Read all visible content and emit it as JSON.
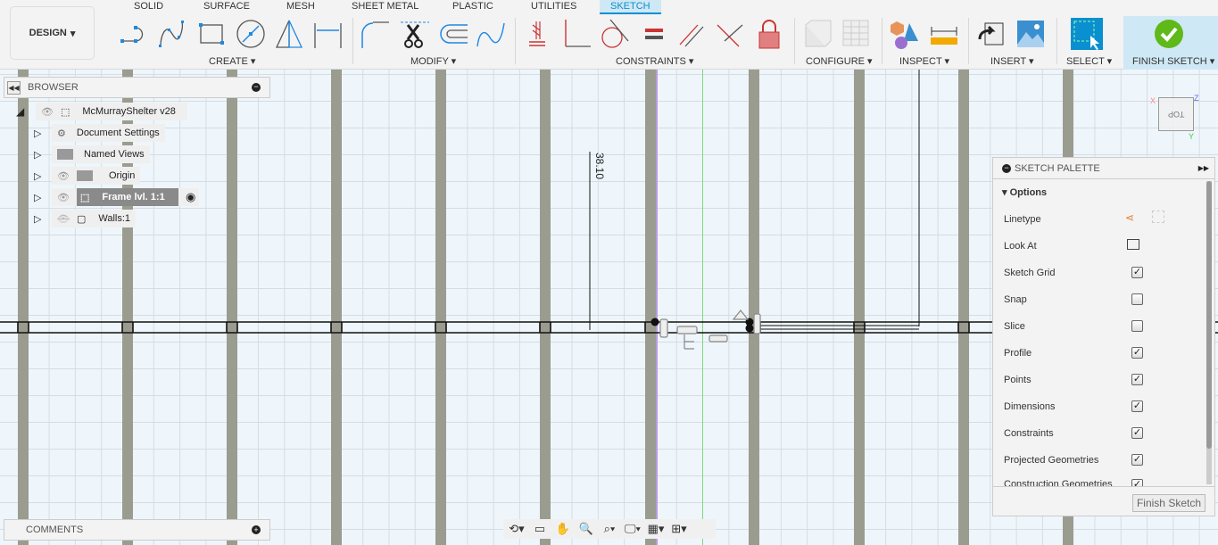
{
  "toolbar": {
    "workspace": "DESIGN",
    "tabs": [
      "SOLID",
      "SURFACE",
      "MESH",
      "SHEET METAL",
      "PLASTIC",
      "UTILITIES",
      "SKETCH"
    ],
    "active_tab": "SKETCH",
    "groups": {
      "create": "CREATE",
      "modify": "MODIFY",
      "constraints": "CONSTRAINTS",
      "configure": "CONFIGURE",
      "inspect": "INSPECT",
      "insert": "INSERT",
      "select": "SELECT",
      "finish": "FINISH SKETCH"
    },
    "accent": "#0a8fd0"
  },
  "browser": {
    "title": "BROWSER",
    "items": [
      {
        "label": "McMurrayShelter v28",
        "icon": "component-icon"
      },
      {
        "label": "Document Settings",
        "icon": "gear-icon"
      },
      {
        "label": "Named Views",
        "icon": "folder-icon"
      },
      {
        "label": "Origin",
        "icon": "folder-icon"
      },
      {
        "label": "Frame lvl. 1:1",
        "icon": "component-icon",
        "active": true
      },
      {
        "label": "Walls:1",
        "icon": "body-icon",
        "hidden": true
      }
    ]
  },
  "comments": {
    "title": "COMMENTS"
  },
  "viewport": {
    "dimension": "38.10",
    "viewcube": "TOP",
    "axes": [
      "X",
      "Y",
      "Z"
    ]
  },
  "palette": {
    "title": "SKETCH PALETTE",
    "section": "Options",
    "linetype": "Linetype",
    "look_at": "Look At",
    "options": [
      {
        "label": "Sketch Grid",
        "checked": true
      },
      {
        "label": "Snap",
        "checked": false
      },
      {
        "label": "Slice",
        "checked": false
      },
      {
        "label": "Profile",
        "checked": true
      },
      {
        "label": "Points",
        "checked": true
      },
      {
        "label": "Dimensions",
        "checked": true
      },
      {
        "label": "Constraints",
        "checked": true
      },
      {
        "label": "Projected Geometries",
        "checked": true
      },
      {
        "label": "Construction Geometries",
        "checked": true
      }
    ],
    "finish_button": "Finish Sketch"
  }
}
